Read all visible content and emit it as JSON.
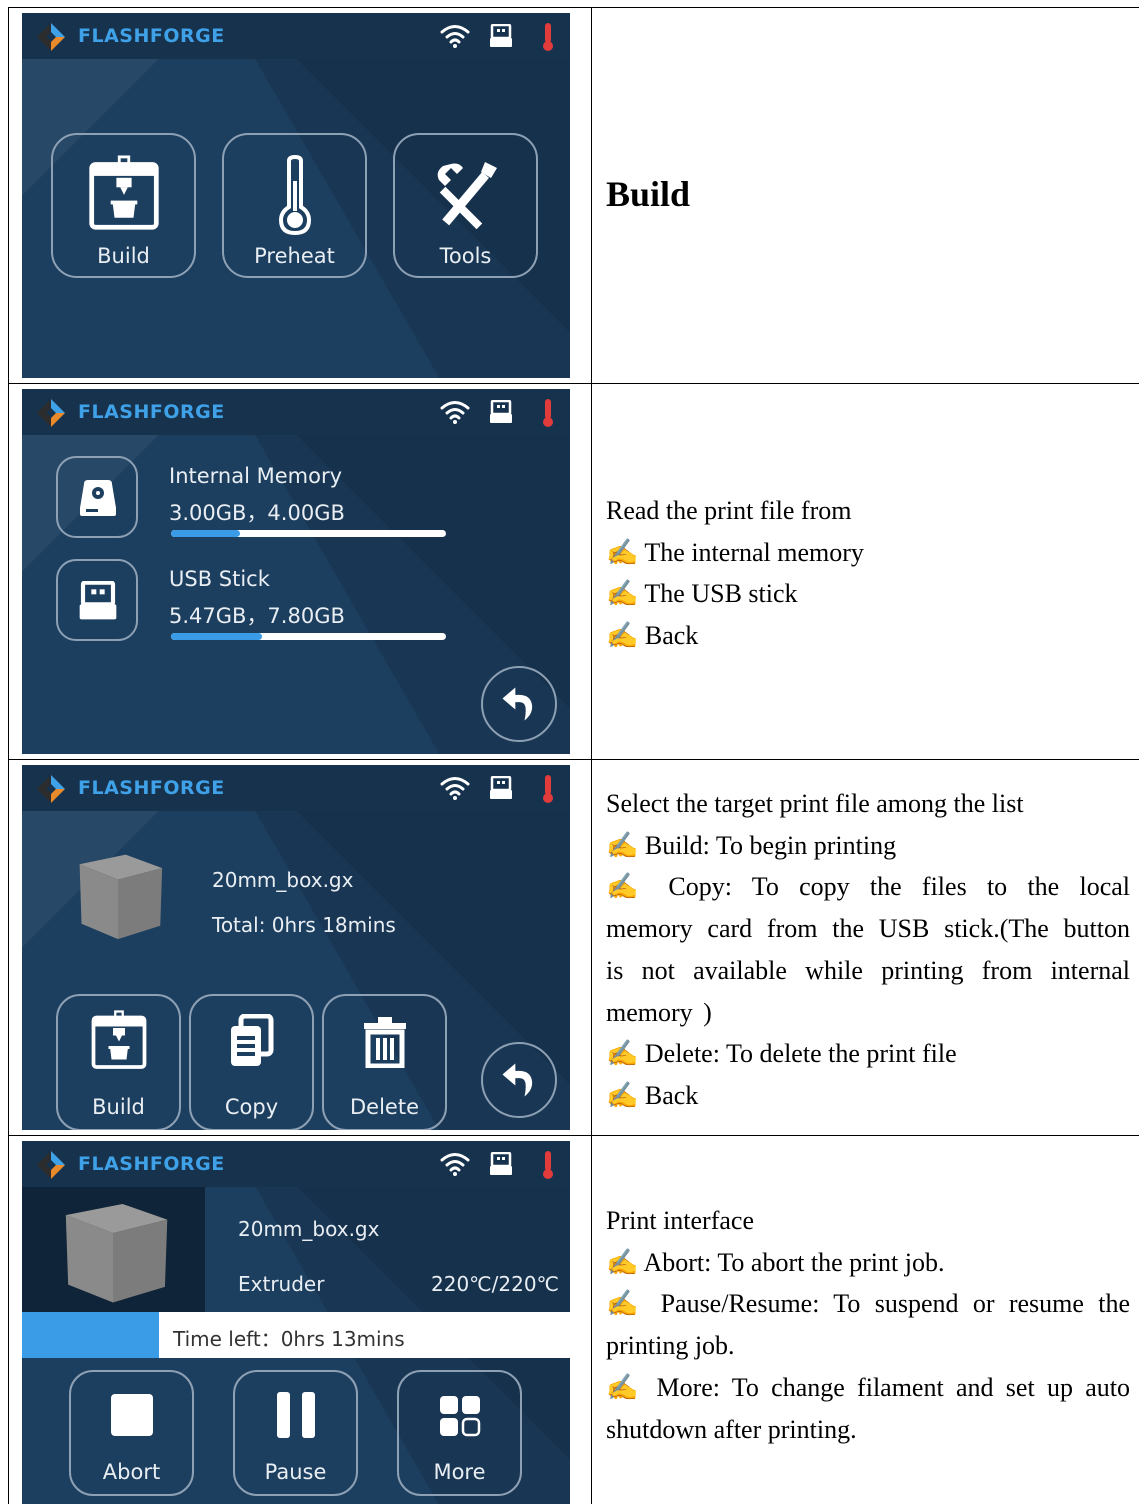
{
  "screens": {
    "brand": "FLASHFORGE",
    "s1": {
      "build": "Build",
      "preheat": "Preheat",
      "tools": "Tools"
    },
    "s2": {
      "internal_title": "Internal Memory",
      "internal_values": "3.00GB，4.00GB",
      "internal_fraction": 0.25,
      "usb_title": "USB Stick",
      "usb_values": "5.47GB，7.80GB",
      "usb_fraction": 0.33
    },
    "s3": {
      "file_name": "20mm_box.gx",
      "total_time": "Total: 0hrs 18mins",
      "build": "Build",
      "copy": "Copy",
      "delete": "Delete"
    },
    "s4": {
      "file_name": "20mm_box.gx",
      "extruder_label": "Extruder",
      "extruder_temp": "220℃/220℃",
      "time_left": "Time left：0hrs 13mins",
      "progress_fraction": 0.25,
      "abort": "Abort",
      "pause": "Pause",
      "more": "More"
    },
    "colors": {
      "screen_bg": "#1c3e5f",
      "topbar": "#17324d",
      "accent": "#3a9ce6",
      "thermo": "#e23b3b"
    }
  },
  "descriptions": {
    "row1": {
      "title": "Build"
    },
    "row2": {
      "intro": "Read the print file from",
      "items": [
        "The internal memory",
        "The USB stick",
        "Back"
      ]
    },
    "row3": {
      "intro": "Select the target print file among the list",
      "items": [
        "Build: To begin printing",
        "Copy:  To  copy  the  files  to  the  local memory  card  from  the  USB  stick.(The button is not available while printing from internal memory )",
        "Delete: To delete the print file",
        "Back"
      ]
    },
    "row4": {
      "intro": "Print interface",
      "items": [
        "Abort: To abort the print job.",
        "Pause/Resume: To suspend or resume the printing job.",
        "More: To change filament and set up auto shutdown after printing."
      ]
    },
    "bullet": "✍"
  }
}
